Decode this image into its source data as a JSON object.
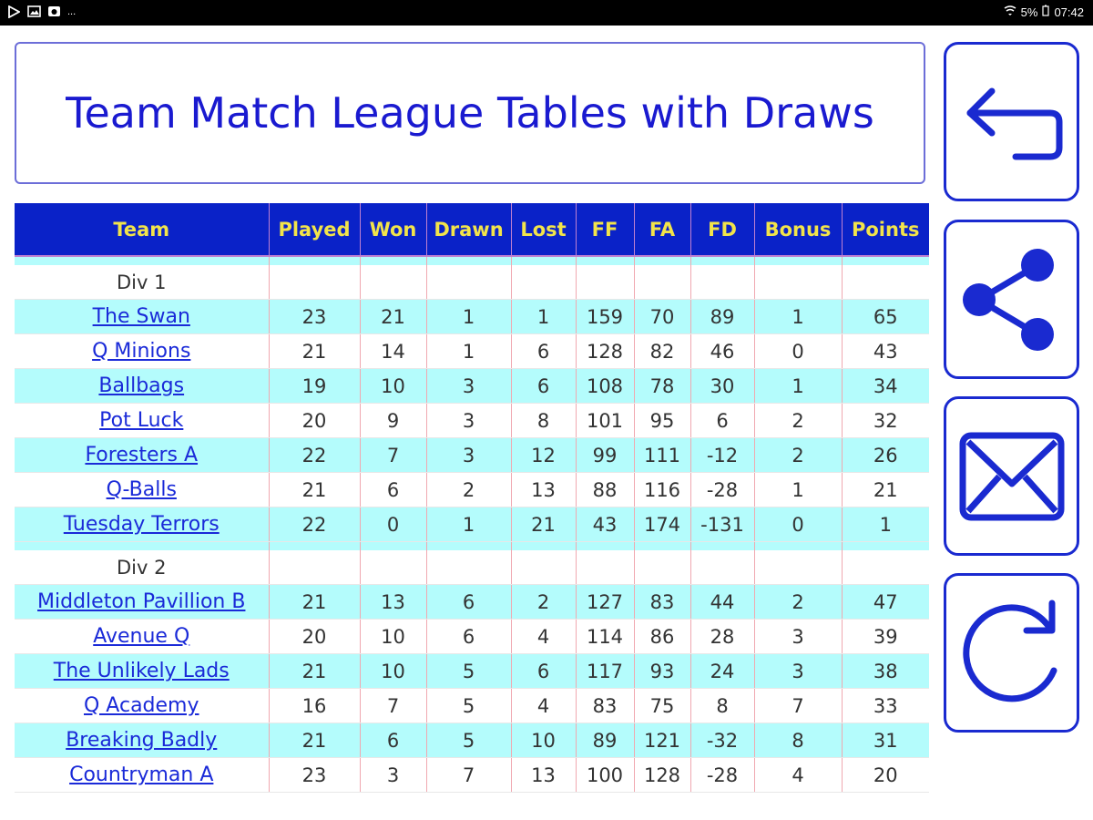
{
  "status_bar": {
    "left_icons": [
      "play-store-icon",
      "gallery-icon",
      "cloud-icon"
    ],
    "more": "...",
    "battery": "5%",
    "time": "07:42"
  },
  "title": "Team Match League Tables with Draws",
  "table": {
    "columns": [
      "Team",
      "Played",
      "Won",
      "Drawn",
      "Lost",
      "FF",
      "FA",
      "FD",
      "Bonus",
      "Points"
    ],
    "divisions": [
      {
        "name": "Div 1",
        "teams": [
          {
            "team": "The Swan",
            "played": "23",
            "won": "21",
            "drawn": "1",
            "lost": "1",
            "ff": "159",
            "fa": "70",
            "fd": "89",
            "bonus": "1",
            "points": "65"
          },
          {
            "team": "Q Minions",
            "played": "21",
            "won": "14",
            "drawn": "1",
            "lost": "6",
            "ff": "128",
            "fa": "82",
            "fd": "46",
            "bonus": "0",
            "points": "43"
          },
          {
            "team": "Ballbags",
            "played": "19",
            "won": "10",
            "drawn": "3",
            "lost": "6",
            "ff": "108",
            "fa": "78",
            "fd": "30",
            "bonus": "1",
            "points": "34"
          },
          {
            "team": "Pot Luck",
            "played": "20",
            "won": "9",
            "drawn": "3",
            "lost": "8",
            "ff": "101",
            "fa": "95",
            "fd": "6",
            "bonus": "2",
            "points": "32"
          },
          {
            "team": "Foresters A",
            "played": "22",
            "won": "7",
            "drawn": "3",
            "lost": "12",
            "ff": "99",
            "fa": "111",
            "fd": "-12",
            "bonus": "2",
            "points": "26"
          },
          {
            "team": "Q-Balls",
            "played": "21",
            "won": "6",
            "drawn": "2",
            "lost": "13",
            "ff": "88",
            "fa": "116",
            "fd": "-28",
            "bonus": "1",
            "points": "21"
          },
          {
            "team": "Tuesday Terrors",
            "played": "22",
            "won": "0",
            "drawn": "1",
            "lost": "21",
            "ff": "43",
            "fa": "174",
            "fd": "-131",
            "bonus": "0",
            "points": "1"
          }
        ]
      },
      {
        "name": "Div 2",
        "teams": [
          {
            "team": "Middleton Pavillion B",
            "played": "21",
            "won": "13",
            "drawn": "6",
            "lost": "2",
            "ff": "127",
            "fa": "83",
            "fd": "44",
            "bonus": "2",
            "points": "47"
          },
          {
            "team": "Avenue Q",
            "played": "20",
            "won": "10",
            "drawn": "6",
            "lost": "4",
            "ff": "114",
            "fa": "86",
            "fd": "28",
            "bonus": "3",
            "points": "39"
          },
          {
            "team": "The Unlikely Lads",
            "played": "21",
            "won": "10",
            "drawn": "5",
            "lost": "6",
            "ff": "117",
            "fa": "93",
            "fd": "24",
            "bonus": "3",
            "points": "38"
          },
          {
            "team": "Q Academy",
            "played": "16",
            "won": "7",
            "drawn": "5",
            "lost": "4",
            "ff": "83",
            "fa": "75",
            "fd": "8",
            "bonus": "7",
            "points": "33"
          },
          {
            "team": "Breaking Badly",
            "played": "21",
            "won": "6",
            "drawn": "5",
            "lost": "10",
            "ff": "89",
            "fa": "121",
            "fd": "-32",
            "bonus": "8",
            "points": "31"
          },
          {
            "team": "Countryman A",
            "played": "23",
            "won": "3",
            "drawn": "7",
            "lost": "13",
            "ff": "100",
            "fa": "128",
            "fd": "-28",
            "bonus": "4",
            "points": "20"
          }
        ]
      }
    ]
  },
  "side_buttons": [
    "back-icon",
    "share-icon",
    "email-icon",
    "refresh-icon"
  ],
  "colors": {
    "header_bg": "#0a22c8",
    "header_text": "#f2e44a",
    "row_highlight": "#b4fcfc",
    "accent": "#1a2ad0"
  }
}
